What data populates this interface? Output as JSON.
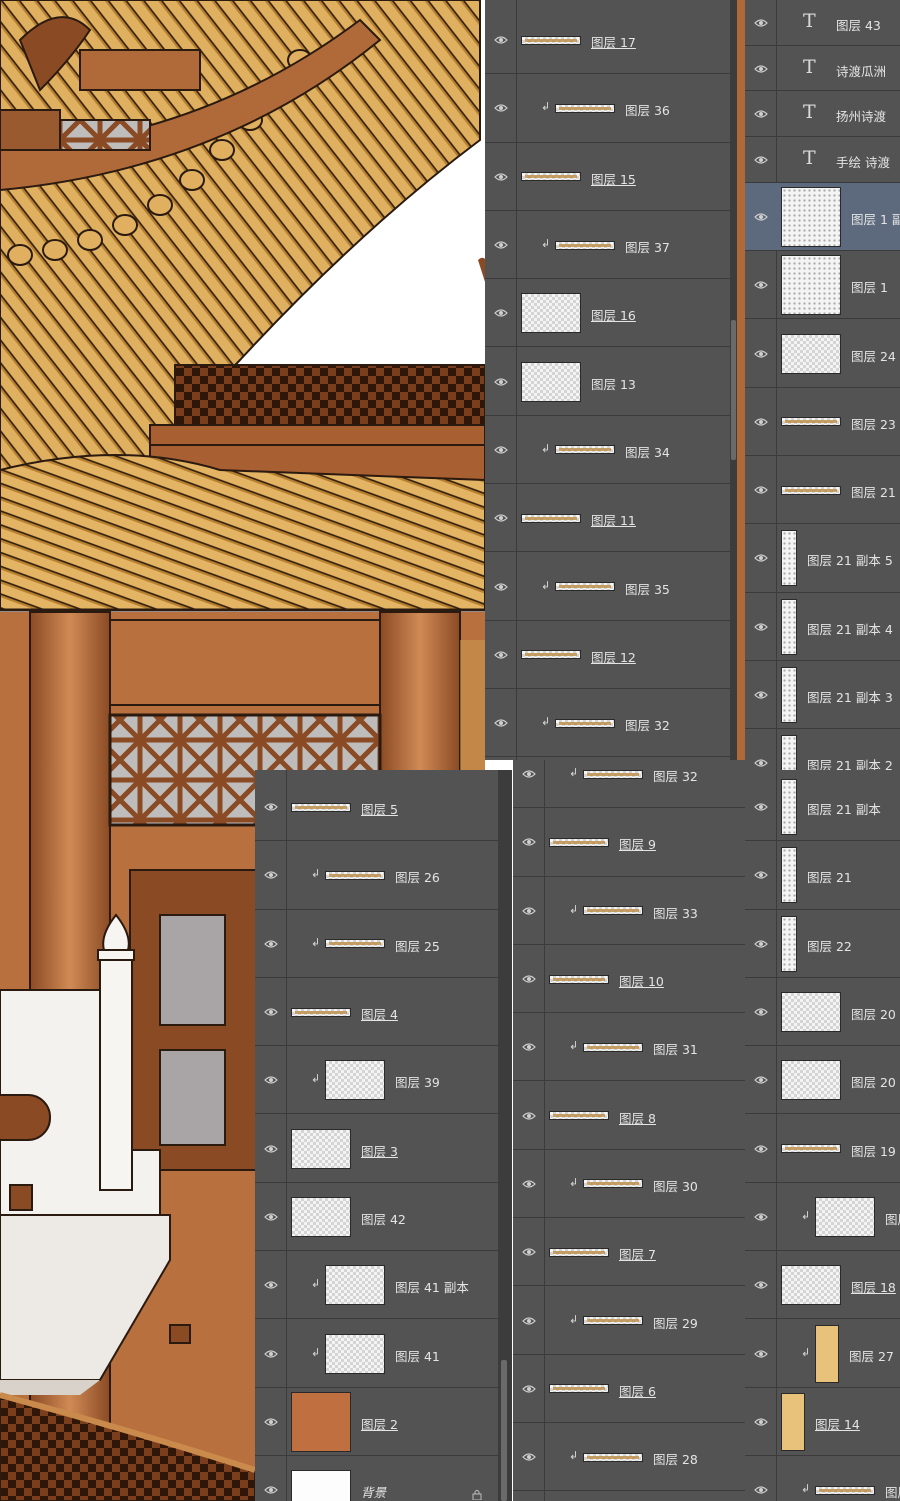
{
  "panels": {
    "top_middle": [
      {
        "name": "图层 17",
        "clip": false,
        "thumb": "wide",
        "u": true
      },
      {
        "name": "图层 36",
        "clip": true,
        "thumb": "wide",
        "u": false
      },
      {
        "name": "图层 15",
        "clip": false,
        "thumb": "wide",
        "u": true
      },
      {
        "name": "图层 37",
        "clip": true,
        "thumb": "wide",
        "u": false
      },
      {
        "name": "图层 16",
        "clip": false,
        "thumb": "box",
        "u": true
      },
      {
        "name": "图层 13",
        "clip": false,
        "thumb": "box",
        "u": false
      },
      {
        "name": "图层 34",
        "clip": true,
        "thumb": "wide",
        "u": false
      },
      {
        "name": "图层 11",
        "clip": false,
        "thumb": "wide",
        "u": true
      },
      {
        "name": "图层 35",
        "clip": true,
        "thumb": "wide",
        "u": false
      },
      {
        "name": "图层 12",
        "clip": false,
        "thumb": "wide",
        "u": true
      },
      {
        "name": "图层 32",
        "clip": true,
        "thumb": "wide",
        "u": false
      }
    ],
    "top_right": [
      {
        "name": "图层 43",
        "kind": "text"
      },
      {
        "name": "诗渡瓜洲",
        "kind": "text"
      },
      {
        "name": "扬州诗渡",
        "kind": "text"
      },
      {
        "name": "手绘 诗渡",
        "kind": "text"
      },
      {
        "name": "图层 1 副本",
        "kind": "dots",
        "selected": true
      },
      {
        "name": "图层 1",
        "kind": "dots"
      },
      {
        "name": "图层 24",
        "kind": "box"
      },
      {
        "name": "图层 23",
        "kind": "wide"
      },
      {
        "name": "图层 21",
        "kind": "wide"
      },
      {
        "name": "图层 21 副本 5",
        "kind": "tall"
      },
      {
        "name": "图层 21 副本 4",
        "kind": "tall"
      },
      {
        "name": "图层 21 副本 3",
        "kind": "tall"
      },
      {
        "name": "图层 21 副本 2",
        "kind": "tall"
      }
    ],
    "bottom_left": [
      {
        "name": "图层 5",
        "clip": false,
        "thumb": "wide",
        "u": true
      },
      {
        "name": "图层 26",
        "clip": true,
        "thumb": "wide",
        "u": false
      },
      {
        "name": "图层 25",
        "clip": true,
        "thumb": "wide",
        "u": false
      },
      {
        "name": "图层 4",
        "clip": false,
        "thumb": "wide",
        "u": true
      },
      {
        "name": "图层 39",
        "clip": true,
        "thumb": "box",
        "u": false
      },
      {
        "name": "图层 3",
        "clip": false,
        "thumb": "box",
        "u": true
      },
      {
        "name": "图层 42",
        "clip": false,
        "thumb": "box",
        "u": false
      },
      {
        "name": "图层 41 副本",
        "clip": true,
        "thumb": "box",
        "u": false
      },
      {
        "name": "图层 41",
        "clip": true,
        "thumb": "box",
        "u": false
      },
      {
        "name": "图层 2",
        "clip": false,
        "thumb": "art",
        "u": true
      },
      {
        "name": "背景",
        "clip": false,
        "thumb": "white",
        "u": false,
        "lock": true
      }
    ],
    "bottom_middle": [
      {
        "name": "图层 32",
        "clip": true,
        "thumb": "wide",
        "u": false
      },
      {
        "name": "图层 9",
        "clip": false,
        "thumb": "wide",
        "u": true
      },
      {
        "name": "图层 33",
        "clip": true,
        "thumb": "wide",
        "u": false
      },
      {
        "name": "图层 10",
        "clip": false,
        "thumb": "wide",
        "u": true
      },
      {
        "name": "图层 31",
        "clip": true,
        "thumb": "wide",
        "u": false
      },
      {
        "name": "图层 8",
        "clip": false,
        "thumb": "wide",
        "u": true
      },
      {
        "name": "图层 30",
        "clip": true,
        "thumb": "wide",
        "u": false
      },
      {
        "name": "图层 7",
        "clip": false,
        "thumb": "wide",
        "u": true
      },
      {
        "name": "图层 29",
        "clip": true,
        "thumb": "wide",
        "u": false
      },
      {
        "name": "图层 6",
        "clip": false,
        "thumb": "wide",
        "u": true
      },
      {
        "name": "图层 28",
        "clip": true,
        "thumb": "wide",
        "u": false
      }
    ],
    "bottom_right": [
      {
        "name": "图层 21 副本",
        "clip": false,
        "thumb": "tall",
        "u": false
      },
      {
        "name": "图层 21",
        "clip": false,
        "thumb": "tall",
        "u": false
      },
      {
        "name": "图层 22",
        "clip": false,
        "thumb": "tall",
        "u": false
      },
      {
        "name": "图层 20",
        "clip": false,
        "thumb": "box",
        "u": false
      },
      {
        "name": "图层 20",
        "clip": false,
        "thumb": "box",
        "u": false
      },
      {
        "name": "图层 19",
        "clip": false,
        "thumb": "wide",
        "u": false
      },
      {
        "name": "图层",
        "clip": true,
        "thumb": "box",
        "u": false
      },
      {
        "name": "图层 18",
        "clip": false,
        "thumb": "box",
        "u": true
      },
      {
        "name": "图层 27",
        "clip": true,
        "thumb": "gold",
        "u": false
      },
      {
        "name": "图层 14",
        "clip": false,
        "thumb": "gold",
        "u": true
      },
      {
        "name": "图层",
        "clip": true,
        "thumb": "wide",
        "u": false
      }
    ]
  },
  "icons": {
    "visibility": "eye-icon",
    "clipping": "clip-arrow-icon",
    "text_layer": "text-layer-icon",
    "lock": "lock-icon"
  },
  "glyphs": {
    "clip": "↲",
    "text": "T"
  },
  "colors": {
    "panel": "#535353",
    "selected": "#5d6a7e",
    "roof_gold": "#c9983f",
    "wood": "#b06a3a",
    "outline": "#2a1a10"
  }
}
